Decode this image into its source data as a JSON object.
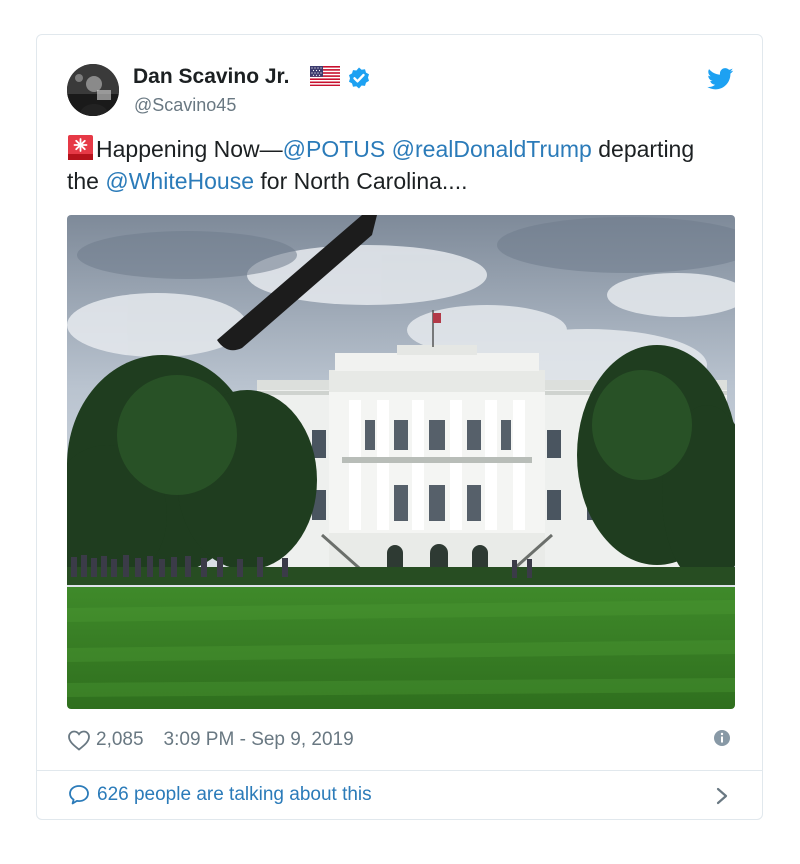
{
  "tweet": {
    "author": {
      "display_name": "Dan Scavino Jr.",
      "handle": "@Scavino45",
      "verified": true,
      "flag_emoji": "us-flag-icon"
    },
    "text": {
      "siren_emoji": "rotating-light-icon",
      "segment_1": "Happening Now—",
      "mention_1": "@POTUS",
      "mention_2": "@realDonaldTrump",
      "segment_2": " departing",
      "segment_3": "the ",
      "mention_3": "@WhiteHouse",
      "segment_4": " for North Carolina...."
    },
    "media": {
      "icon": "photo-white-house-with-helicopter-rotor"
    },
    "likes": "2,085",
    "timestamp": "3:09 PM - Sep 9, 2019",
    "conversation_label": "626 people are talking about this"
  },
  "icons": {
    "brand": "twitter-bird-icon",
    "like": "heart-icon",
    "info": "info-icon",
    "reply": "speech-bubble-icon",
    "chevron": "chevron-right-icon"
  },
  "colors": {
    "link": "#2b7bb9",
    "brand": "#1da1f2",
    "meta_text": "#697882",
    "border": "#e1e8ed",
    "primary_text": "#1c2022"
  }
}
